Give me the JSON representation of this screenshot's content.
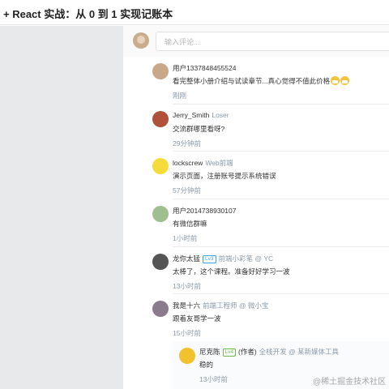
{
  "header": {
    "title": "+ React 实战：从 0 到 1 实现记账本"
  },
  "comment_input": {
    "placeholder": "输入评论..."
  },
  "comments": [
    {
      "user": "用户1337848455524",
      "tag": "",
      "content": "看完整体小册介绍与试读章节...真心觉得不值此价格",
      "time": "刚刚",
      "has_emoji": true,
      "avatar_color": "#c9a889"
    },
    {
      "user": "Jerry_Smith",
      "tag": "Loser",
      "content": "交流群哪里看呀?",
      "time": "29分钟前",
      "avatar_color": "#b0523a"
    },
    {
      "user": "lockscrew",
      "tag": "Web前端",
      "content": "演示页面，注册账号提示系统错误",
      "time": "57分钟前",
      "avatar_color": "#f5dc3a"
    },
    {
      "user": "用户2014738930107",
      "tag": "",
      "content": "有微信群嘛",
      "time": "1小时前",
      "avatar_color": "#9fbf8f"
    },
    {
      "user": "龙你太猛",
      "level": "Lv3",
      "tag": "前端小彩笔 @ YC",
      "content": "太棒了，这个课程。准备好好学习一波",
      "time": "13小时前",
      "avatar_color": "#555555"
    },
    {
      "user": "我是十六",
      "tag": "前端工程师 @ 微小宝",
      "content": "跟着友哥学一波",
      "time": "15小时前",
      "avatar_color": "#8a7b8c"
    }
  ],
  "reply": {
    "user": "尼克陈",
    "level": "Lv4",
    "author_badge": "(作者)",
    "tag": "全栈开发 @ 某新媒体工具",
    "content": "稳的",
    "time": "13小时前",
    "avatar_color": "#f2c12e"
  },
  "watermark": "@稀土掘金技术社区"
}
